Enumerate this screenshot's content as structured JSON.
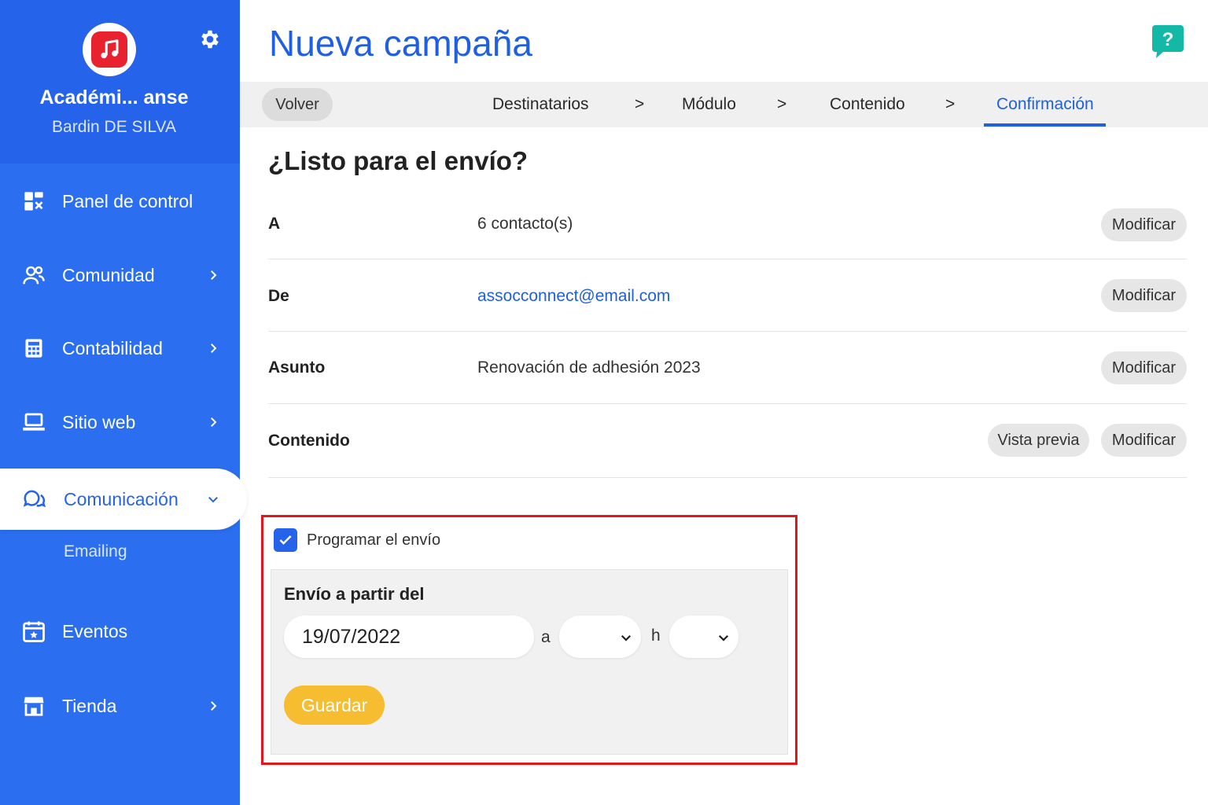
{
  "sidebar": {
    "org_name": "Académi... anse",
    "user_name": "Bardin DE SILVA",
    "items": [
      {
        "label": "Panel de control"
      },
      {
        "label": "Comunidad"
      },
      {
        "label": "Contabilidad"
      },
      {
        "label": "Sitio web"
      },
      {
        "label": "Comunicación"
      },
      {
        "label": "Eventos"
      },
      {
        "label": "Tienda"
      }
    ],
    "sub_item": "Emailing"
  },
  "header": {
    "title": "Nueva campaña",
    "help_symbol": "?"
  },
  "stepper": {
    "back_label": "Volver",
    "steps": [
      "Destinatarios",
      "Módulo",
      "Contenido",
      "Confirmación"
    ],
    "separator": ">",
    "active_step": "Confirmación"
  },
  "summary": {
    "title": "¿Listo para el envío?",
    "rows": [
      {
        "label": "A",
        "value": "6 contacto(s)",
        "action": "Modificar"
      },
      {
        "label": "De",
        "value": "assocconnect@email.com",
        "action": "Modificar"
      },
      {
        "label": "Asunto",
        "value": "Renovación de adhesión 2023",
        "action": "Modificar"
      },
      {
        "label": "Contenido",
        "value": "",
        "preview": "Vista previa",
        "action": "Modificar"
      }
    ]
  },
  "schedule": {
    "checkbox_label": "Programar el envío",
    "checked": true,
    "panel_title": "Envío a partir del",
    "date": "19/07/2022",
    "sep_at": "a",
    "sep_hour": "h",
    "hour": "",
    "minute": "",
    "save_label": "Guardar"
  },
  "colors": {
    "sidebar": "#2b6ef0",
    "primary": "#1f5fe0",
    "highlight_border": "#e3161e",
    "save_button": "#f5bd2f",
    "help_button": "#14b8a6",
    "logo": "#e8222f"
  }
}
